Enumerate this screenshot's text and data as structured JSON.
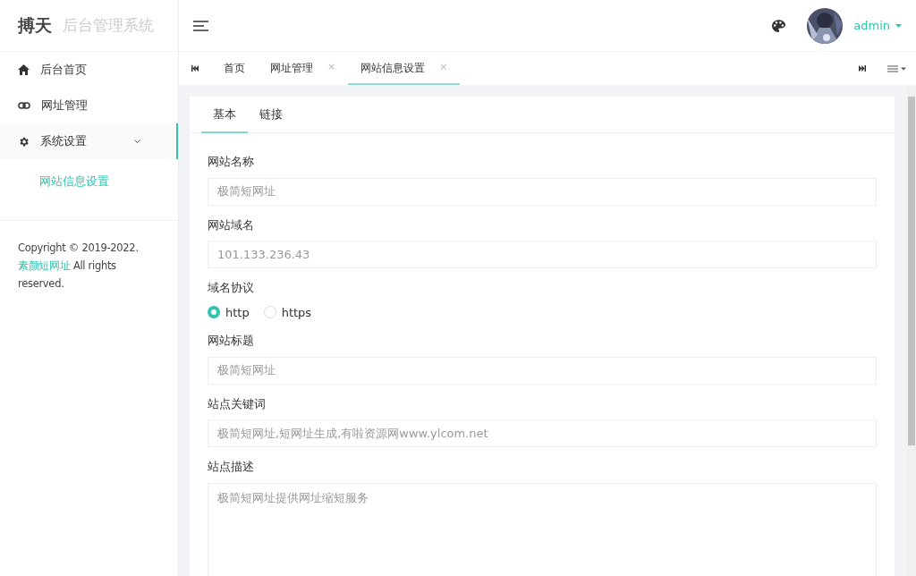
{
  "brand": {
    "name": "搏天",
    "subtitle": "后台管理系统"
  },
  "header": {
    "user": "admin"
  },
  "sidebar": {
    "items": [
      {
        "label": "后台首页",
        "kind": "home",
        "selected": false
      },
      {
        "label": "网址管理",
        "kind": "link",
        "selected": false
      },
      {
        "label": "系统设置",
        "kind": "gear",
        "selected": true,
        "expanded": true,
        "children": [
          {
            "label": "网站信息设置",
            "selected": true
          }
        ]
      }
    ],
    "footer": {
      "prefix": "Copyright © 2019-2022.",
      "link": "素颜短网址",
      "suffix": "All rights reserved."
    }
  },
  "tabs": [
    {
      "label": "首页",
      "closable": false,
      "selected": false
    },
    {
      "label": "网址管理",
      "closable": true,
      "selected": false
    },
    {
      "label": "网站信息设置",
      "closable": true,
      "selected": true
    }
  ],
  "close_glyph": "×",
  "form_tabs": [
    {
      "label": "基本",
      "selected": true
    },
    {
      "label": "链接",
      "selected": false
    }
  ],
  "fields": [
    {
      "kind": "text",
      "label": "网站名称",
      "value": "极简短网址"
    },
    {
      "kind": "text",
      "label": "网站域名",
      "value": "101.133.236.43"
    },
    {
      "kind": "radio",
      "label": "域名协议",
      "options": [
        {
          "label": "http",
          "selected": true
        },
        {
          "label": "https",
          "selected": false
        }
      ]
    },
    {
      "kind": "text",
      "label": "网站标题",
      "value": "极简短网址"
    },
    {
      "kind": "text",
      "label": "站点关键词",
      "value": "极简短网址,短网址生成,有啦资源网www.ylcom.net"
    },
    {
      "kind": "textarea",
      "label": "站点描述",
      "value": "极简短网址提供网址缩短服务"
    }
  ]
}
